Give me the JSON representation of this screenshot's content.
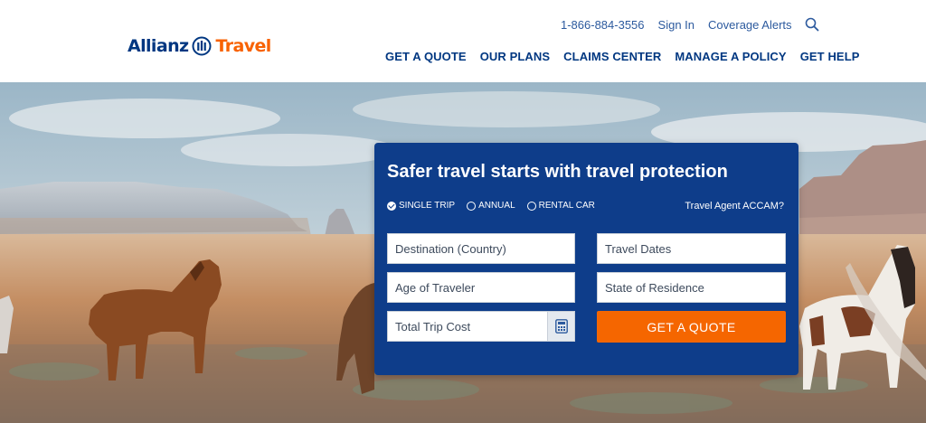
{
  "brand": {
    "name_part1": "Allianz",
    "name_part2": "Travel",
    "primary_color": "#003781",
    "accent_color": "#f86200"
  },
  "utility_nav": {
    "phone": "1-866-884-3556",
    "sign_in": "Sign In",
    "coverage_alerts": "Coverage Alerts",
    "search_icon": "search-icon"
  },
  "main_nav": {
    "items": [
      "GET A QUOTE",
      "OUR PLANS",
      "CLAIMS CENTER",
      "MANAGE A POLICY",
      "GET HELP"
    ]
  },
  "quote_panel": {
    "title": "Safer travel starts with travel protection",
    "trip_types": [
      {
        "label": "SINGLE TRIP",
        "selected": true
      },
      {
        "label": "ANNUAL",
        "selected": false
      },
      {
        "label": "RENTAL CAR",
        "selected": false
      }
    ],
    "agent_link": "Travel Agent ACCAM?",
    "fields": {
      "destination_placeholder": "Destination (Country)",
      "dates_placeholder": "Travel Dates",
      "age_placeholder": "Age of Traveler",
      "state_placeholder": "State of Residence",
      "cost_placeholder": "Total Trip Cost"
    },
    "submit_label": "GET A QUOTE",
    "panel_color": "#0e3d8a",
    "button_color": "#f56600"
  }
}
